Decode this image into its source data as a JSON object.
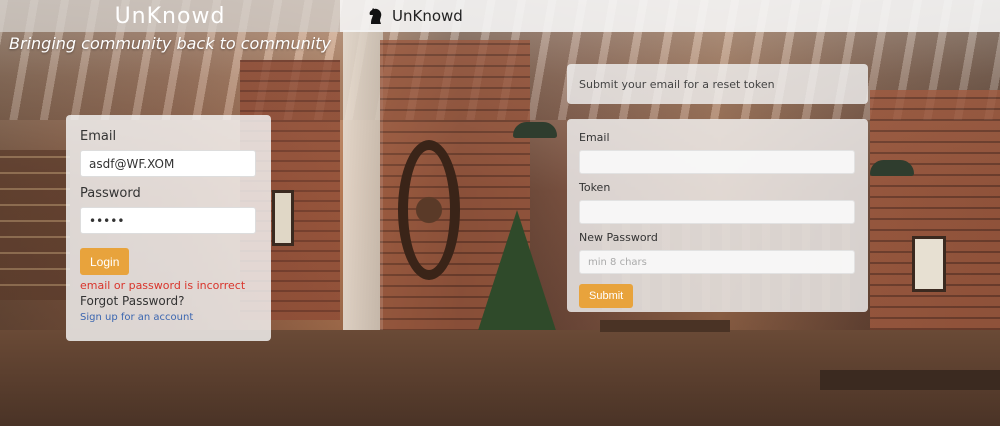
{
  "left_header": {
    "brand": "UnKnowd",
    "tagline": "Bringing community back to community"
  },
  "login": {
    "email_label": "Email",
    "email_value": "asdf@WF.XOM",
    "password_label": "Password",
    "password_value": "•••••",
    "login_button": "Login",
    "error_text": "email or password is incorrect",
    "forgot_text": "Forgot Password?",
    "signup_text": "Sign up for an account"
  },
  "navbar": {
    "brand": "UnKnowd",
    "logo_icon": "knight-chess-icon"
  },
  "reset": {
    "info_text": "Submit your email for a reset token",
    "email_label": "Email",
    "email_value": "",
    "token_label": "Token",
    "token_value": "",
    "new_password_label": "New Password",
    "new_password_placeholder": "min 8 chars",
    "submit_button": "Submit"
  },
  "colors": {
    "accent": "#e8a33c",
    "error": "#d9342b",
    "link": "#3b66b0"
  }
}
